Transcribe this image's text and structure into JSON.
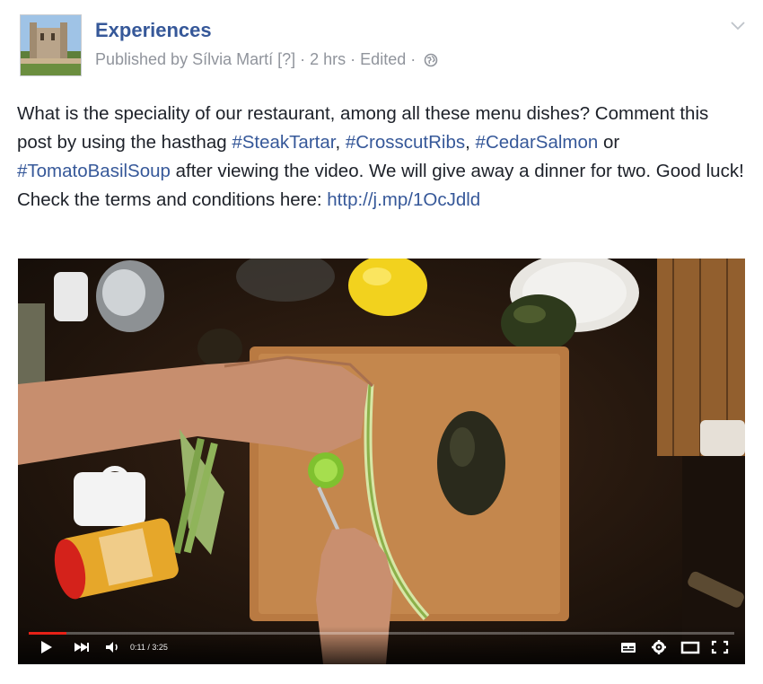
{
  "post": {
    "page_name": "Experiences",
    "published_prefix": "Published by ",
    "author": "Sílvia Martí",
    "author_tag": "[?]",
    "sep1": " · ",
    "time": "2 hrs",
    "sep2": " · ",
    "edited": "Edited",
    "sep3": " · ",
    "audience_icon": "globe-icon",
    "menu_icon": "chevron-down-icon"
  },
  "body": {
    "t1": "What is the speciality of our restaurant, among all these menu dishes? Comment this post by using the hasthag ",
    "h1": "#SteakTartar",
    "t2": ", ",
    "h2": "#CrosscutRibs",
    "t3": ", ",
    "h3": "#CedarSalmon",
    "t4": " or ",
    "h4": "#TomatoBasilSoup",
    "t5": " after viewing the video. We will give away a dinner for two. Good luck! Check the terms and conditions here: ",
    "link": "http://j.mp/1OcJdld"
  },
  "video": {
    "time_display": "0:11 / 3:25",
    "progress": 0.054,
    "icons": [
      "play-icon",
      "next-icon",
      "volume-icon",
      "captions-icon",
      "settings-icon",
      "theater-icon",
      "fullscreen-icon"
    ]
  },
  "colors": {
    "link": "#365899",
    "meta": "#90949c",
    "progress": "#e62117"
  }
}
